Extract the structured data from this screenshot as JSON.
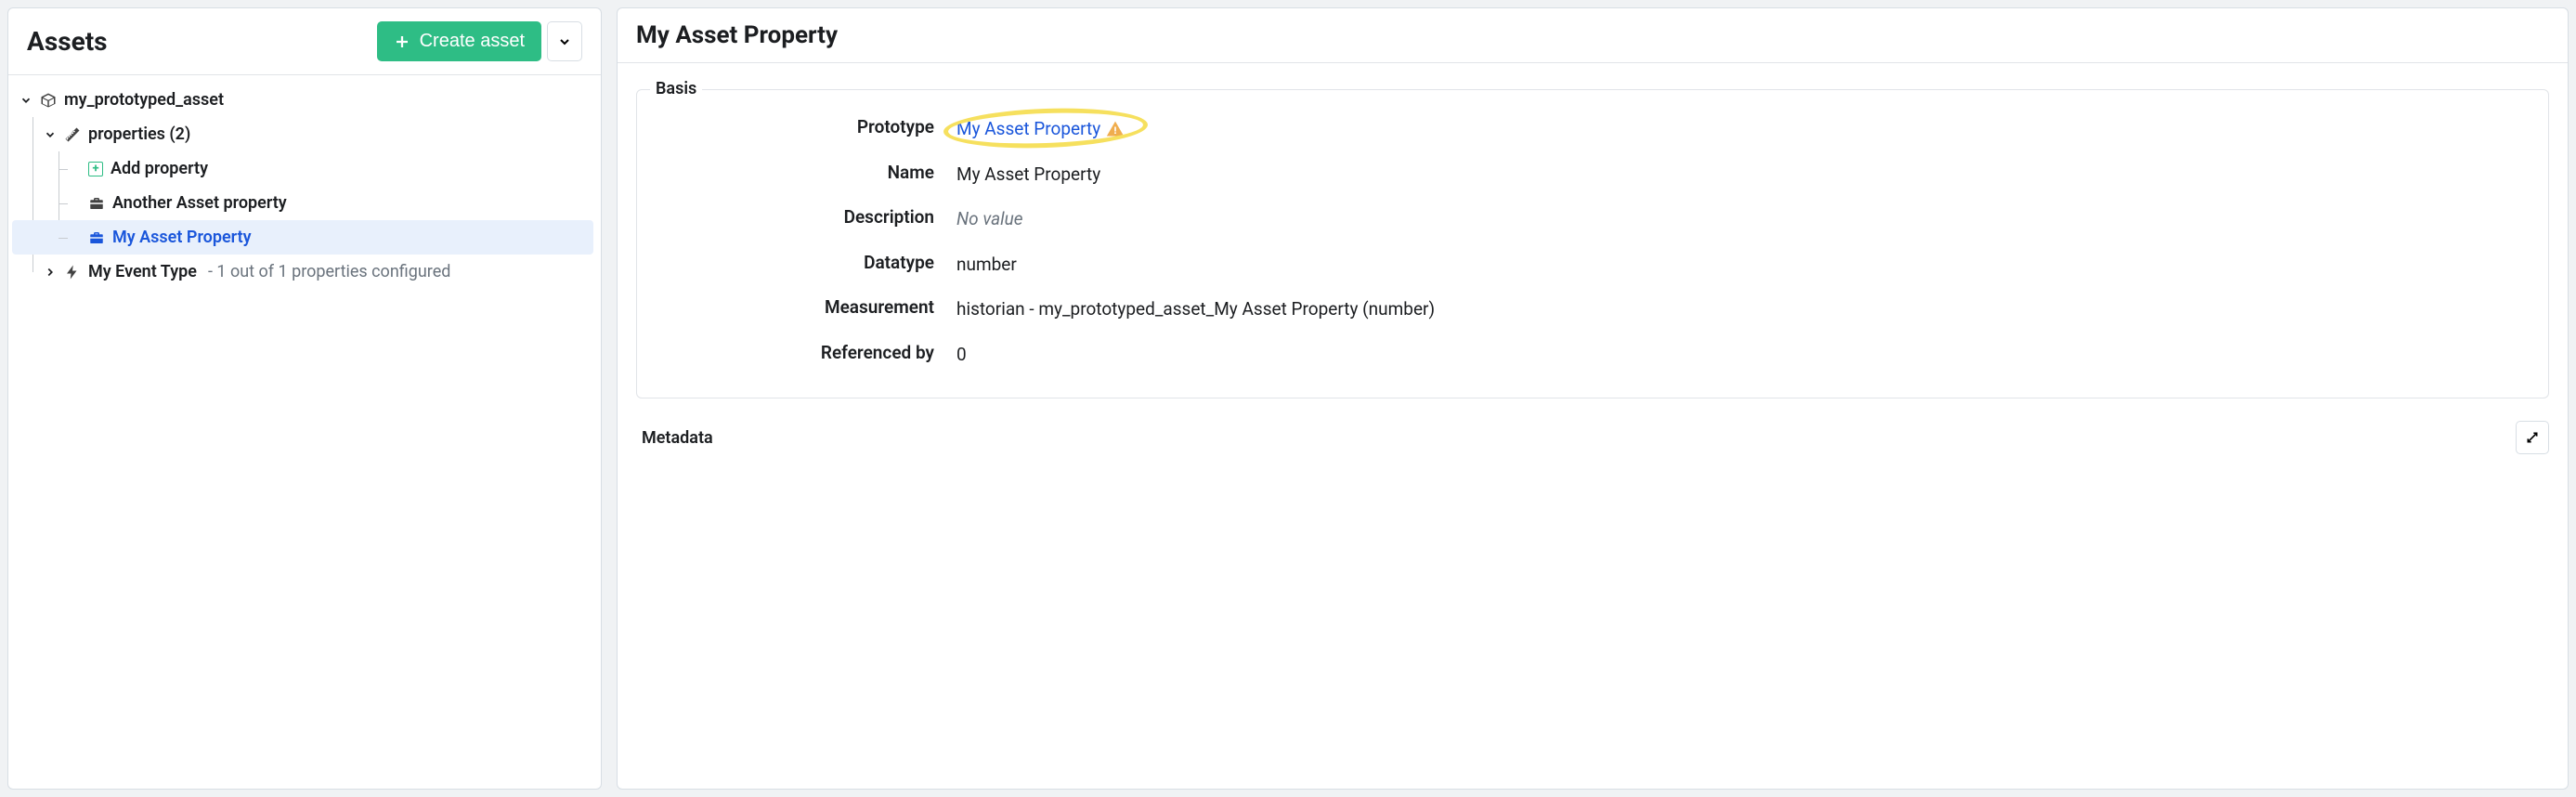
{
  "left": {
    "title": "Assets",
    "create_label": "Create asset",
    "tree": {
      "root_label": "my_prototyped_asset",
      "properties_label": "properties (2)",
      "add_property_label": "Add property",
      "item_another": "Another Asset property",
      "item_selected": "My Asset Property",
      "event_type_label": "My Event Type",
      "event_type_note": "- 1 out of 1 properties configured"
    }
  },
  "right": {
    "title": "My Asset Property",
    "basis_legend": "Basis",
    "metadata_legend": "Metadata",
    "fields": {
      "prototype_key": "Prototype",
      "prototype_val": "My Asset Property",
      "name_key": "Name",
      "name_val": "My Asset Property",
      "description_key": "Description",
      "description_val": "No value",
      "datatype_key": "Datatype",
      "datatype_val": "number",
      "measurement_key": "Measurement",
      "measurement_val": "historian - my_prototyped_asset_My Asset Property (number)",
      "referencedby_key": "Referenced by",
      "referencedby_val": "0"
    }
  }
}
